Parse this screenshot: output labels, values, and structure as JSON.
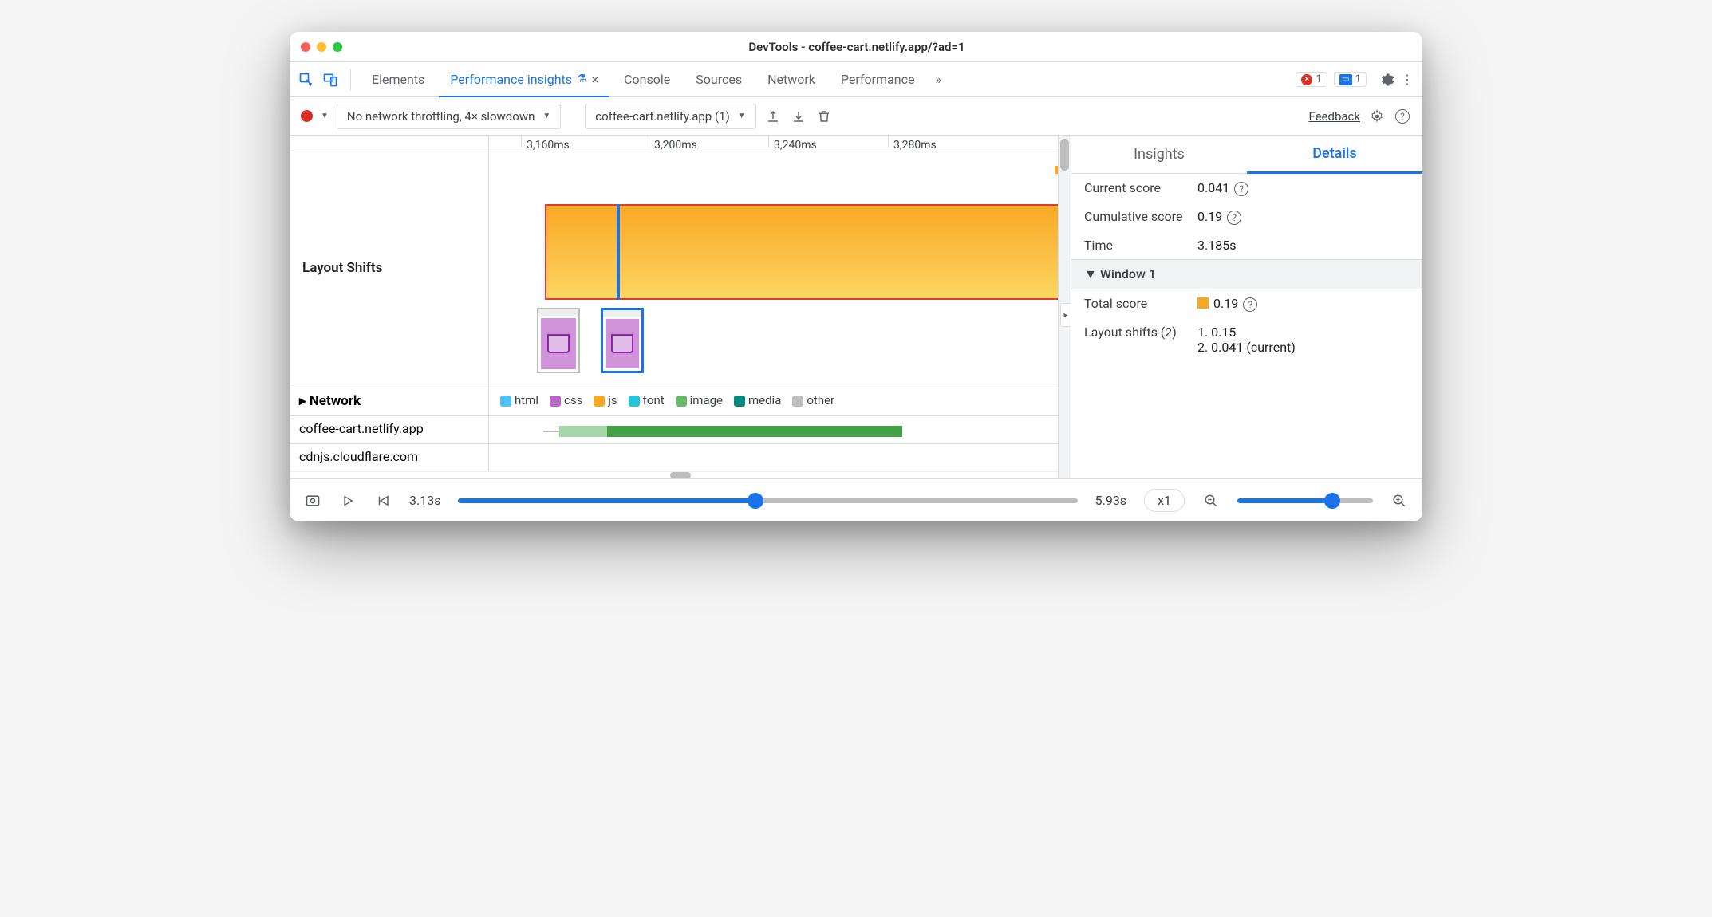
{
  "window_title": "DevTools - coffee-cart.netlify.app/?ad=1",
  "tabs": [
    "Elements",
    "Performance insights",
    "Console",
    "Sources",
    "Network",
    "Performance"
  ],
  "active_tab": "Performance insights",
  "error_badge": "1",
  "msg_badge": "1",
  "toolbar": {
    "throttling": "No network throttling, 4× slowdown",
    "session": "coffee-cart.netlify.app (1)",
    "feedback": "Feedback"
  },
  "ruler": [
    "3,160ms",
    "3,200ms",
    "3,240ms",
    "3,280ms"
  ],
  "row_layout_shifts": "Layout Shifts",
  "row_network": "Network",
  "legend": {
    "html": "html",
    "css": "css",
    "js": "js",
    "font": "font",
    "image": "image",
    "media": "media",
    "other": "other"
  },
  "legend_colors": {
    "html": "#4fc3f7",
    "css": "#ba68c8",
    "js": "#f9a825",
    "font": "#26c6da",
    "image": "#66bb6a",
    "media": "#00897b",
    "other": "#bdbdbd"
  },
  "hosts": [
    "coffee-cart.netlify.app",
    "cdnjs.cloudflare.com"
  ],
  "rtabs": {
    "insights": "Insights",
    "details": "Details"
  },
  "details": {
    "current_score_k": "Current score",
    "current_score_v": "0.041",
    "cumulative_k": "Cumulative score",
    "cumulative_v": "0.19",
    "time_k": "Time",
    "time_v": "3.185s",
    "window_heading": "Window 1",
    "total_score_k": "Total score",
    "total_score_v": "0.19",
    "shifts_k": "Layout shifts (2)",
    "shift1": "1. 0.15",
    "shift2": "2. 0.041 (current)"
  },
  "footer": {
    "start": "3.13s",
    "end": "5.93s",
    "speed": "x1"
  },
  "main_slider_pct": 48,
  "zoom_slider_pct": 70
}
